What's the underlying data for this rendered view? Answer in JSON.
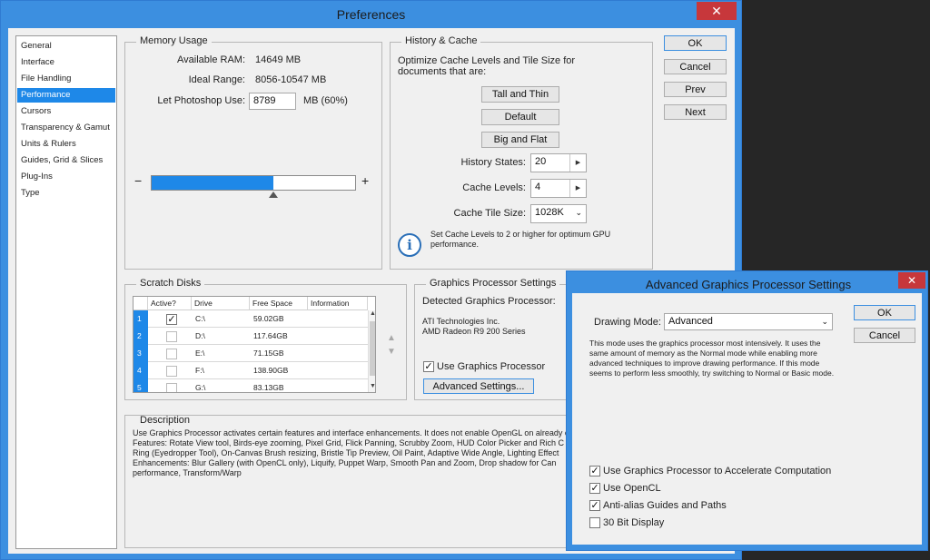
{
  "window": {
    "title": "Preferences",
    "close_glyph": "✕"
  },
  "categories": [
    "General",
    "Interface",
    "File Handling",
    "Performance",
    "Cursors",
    "Transparency & Gamut",
    "Units & Rulers",
    "Guides, Grid & Slices",
    "Plug-Ins",
    "Type"
  ],
  "selected_category": "Performance",
  "side_buttons": {
    "ok": "OK",
    "cancel": "Cancel",
    "prev": "Prev",
    "next": "Next"
  },
  "memory": {
    "legend": "Memory Usage",
    "available_label": "Available RAM:",
    "available_value": "14649 MB",
    "ideal_label": "Ideal Range:",
    "ideal_value": "8056-10547 MB",
    "let_label": "Let Photoshop Use:",
    "let_value": "8789",
    "let_suffix": "MB (60%)",
    "minus": "−",
    "plus": "+",
    "slider_fraction": 0.6
  },
  "history": {
    "legend": "History & Cache",
    "optimize_text": "Optimize Cache Levels and Tile Size for documents that are:",
    "btn_tall": "Tall and Thin",
    "btn_default": "Default",
    "btn_big": "Big and Flat",
    "states_label": "History States:",
    "states_value": "20",
    "levels_label": "Cache Levels:",
    "levels_value": "4",
    "tile_label": "Cache Tile Size:",
    "tile_value": "1028K",
    "info_text": "Set Cache Levels to 2 or higher for optimum GPU performance.",
    "info_glyph": "i"
  },
  "scratch": {
    "legend": "Scratch Disks",
    "columns": [
      "Active?",
      "Drive",
      "Free Space",
      "Information"
    ],
    "rows": [
      {
        "num": "1",
        "active": true,
        "drive": "C:\\",
        "free": "59.02GB",
        "info": ""
      },
      {
        "num": "2",
        "active": false,
        "drive": "D:\\",
        "free": "117.64GB",
        "info": ""
      },
      {
        "num": "3",
        "active": false,
        "drive": "E:\\",
        "free": "71.15GB",
        "info": ""
      },
      {
        "num": "4",
        "active": false,
        "drive": "F:\\",
        "free": "138.90GB",
        "info": ""
      },
      {
        "num": "5",
        "active": false,
        "drive": "G:\\",
        "free": "83.13GB",
        "info": ""
      }
    ]
  },
  "gpu": {
    "legend": "Graphics Processor Settings",
    "detected_label": "Detected Graphics Processor:",
    "vendor": "ATI Technologies Inc.",
    "model": "AMD Radeon R9 200 Series",
    "use_label": "Use Graphics Processor",
    "use_checked": true,
    "advanced_button": "Advanced Settings..."
  },
  "description": {
    "legend": "Description",
    "lines": [
      "Use Graphics Processor activates certain features and interface enhancements. It does not enable OpenGL on already o",
      "Features: Rotate View tool, Birds-eye zooming, Pixel Grid, Flick Panning, Scrubby Zoom, HUD Color Picker and Rich C",
      "Ring (Eyedropper Tool), On-Canvas Brush resizing, Bristle Tip Preview, Oil Paint, Adaptive Wide Angle, Lighting Effect",
      "Enhancements: Blur Gallery (with OpenCL only), Liquify, Puppet Warp, Smooth Pan and Zoom, Drop shadow for Can",
      "performance, Transform/Warp"
    ]
  },
  "advanced": {
    "title": "Advanced Graphics Processor Settings",
    "close_glyph": "✕",
    "mode_label": "Drawing Mode:",
    "mode_value": "Advanced",
    "mode_desc": "This mode uses the graphics processor most intensively.  It uses the same amount of memory as the Normal mode while enabling more advanced techniques to improve drawing performance.  If this mode seems to perform less smoothly, try switching to Normal or Basic mode.",
    "ok": "OK",
    "cancel": "Cancel",
    "options": [
      {
        "label": "Use Graphics Processor to Accelerate Computation",
        "checked": true
      },
      {
        "label": "Use OpenCL",
        "checked": true
      },
      {
        "label": "Anti-alias Guides and Paths",
        "checked": true
      },
      {
        "label": "30 Bit Display",
        "checked": false
      }
    ]
  },
  "colors": {
    "accent": "#1e88e8",
    "frame": "#3c8fe0",
    "close": "#c7373b"
  }
}
